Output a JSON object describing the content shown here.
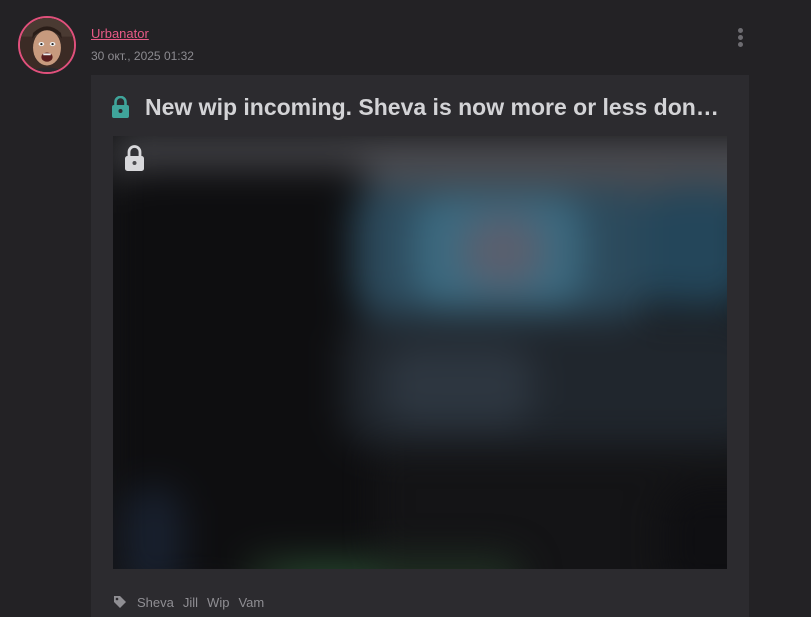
{
  "post": {
    "author": "Urbanator",
    "timestamp": "30 окт., 2025 01:32",
    "title": "New wip incoming. Sheva is now more or less done and is being tested on Jill model",
    "title_locked": true,
    "preview_locked": true,
    "preview_blurred": true,
    "tags": [
      "Sheva",
      "Jill",
      "Wip",
      "Vam"
    ]
  },
  "icons": {
    "more": "more-vertical-icon",
    "title_lock": "lock-icon",
    "preview_lock": "lock-icon",
    "tags": "tag-icon"
  },
  "colors": {
    "background": "#232225",
    "card": "#2c2b2f",
    "author_link": "#e85a86",
    "avatar_ring": "#e0507c",
    "lock_accent": "#3fa49a",
    "text": "#d3d3d6",
    "muted": "#8c8b90"
  }
}
